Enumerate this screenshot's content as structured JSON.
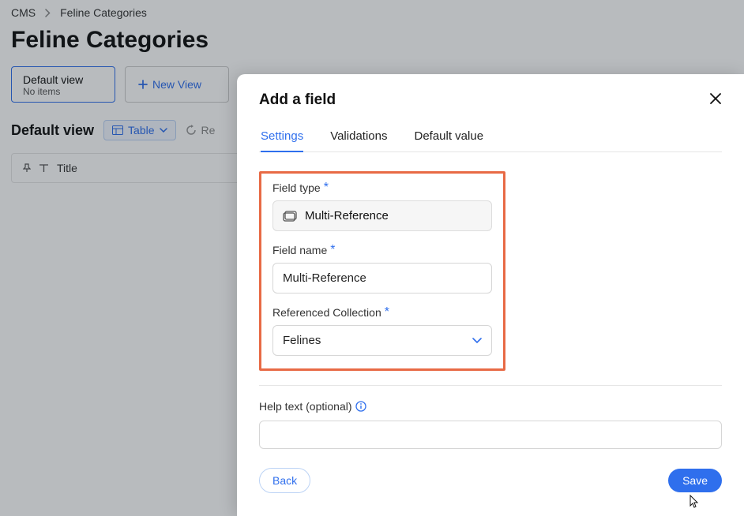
{
  "breadcrumb": {
    "root": "CMS",
    "current": "Feline Categories"
  },
  "page": {
    "title": "Feline Categories"
  },
  "views": {
    "default": {
      "label": "Default view",
      "sub": "No items"
    },
    "new_view_label": "New View"
  },
  "toolbar": {
    "view_title": "Default view",
    "table_label": "Table",
    "refresh_prefix": "Re"
  },
  "grid": {
    "column_title": "Title"
  },
  "modal": {
    "title": "Add a field",
    "tabs": {
      "settings": "Settings",
      "validations": "Validations",
      "default_value": "Default value"
    },
    "field_type": {
      "label": "Field type",
      "value": "Multi-Reference"
    },
    "field_name": {
      "label": "Field name",
      "value": "Multi-Reference"
    },
    "ref_collection": {
      "label": "Referenced Collection",
      "value": "Felines"
    },
    "help_text": {
      "label": "Help text (optional)",
      "value": ""
    },
    "buttons": {
      "back": "Back",
      "save": "Save"
    }
  }
}
